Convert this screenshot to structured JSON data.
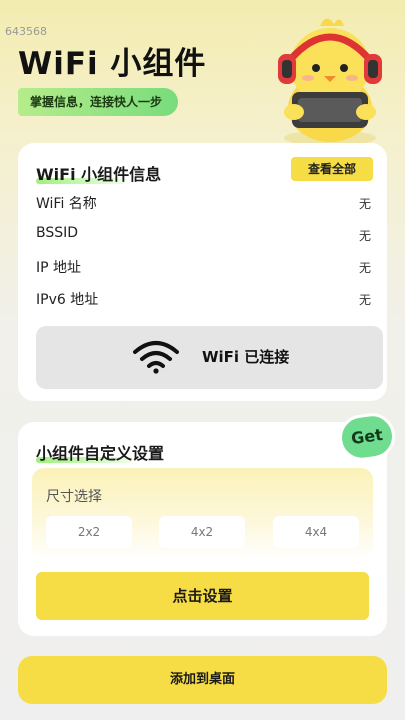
{
  "corner_id": "643568",
  "header": {
    "title": "WiFi 小组件",
    "slogan": "掌握信息，连接快人一步"
  },
  "info_card": {
    "title": "WiFi 小组件信息",
    "view_all_label": "查看全部",
    "rows": [
      {
        "label": "WiFi 名称",
        "value": "无"
      },
      {
        "label": "BSSID",
        "value": "无"
      },
      {
        "label": "IP 地址",
        "value": "无"
      },
      {
        "label": "IPv6 地址",
        "value": "无"
      }
    ],
    "status_text": "WiFi 已连接",
    "status_icon": "wifi-icon"
  },
  "custom_card": {
    "title": "小组件自定义设置",
    "badge": "Get",
    "size_label": "尺寸选择",
    "size_options": [
      "2x2",
      "4x2",
      "4x4"
    ],
    "set_button": "点击设置"
  },
  "add_button": "添加到桌面",
  "colors": {
    "accent_yellow": "#f7dd45",
    "accent_green": "#78dc7b",
    "card_bg": "#ffffff"
  }
}
